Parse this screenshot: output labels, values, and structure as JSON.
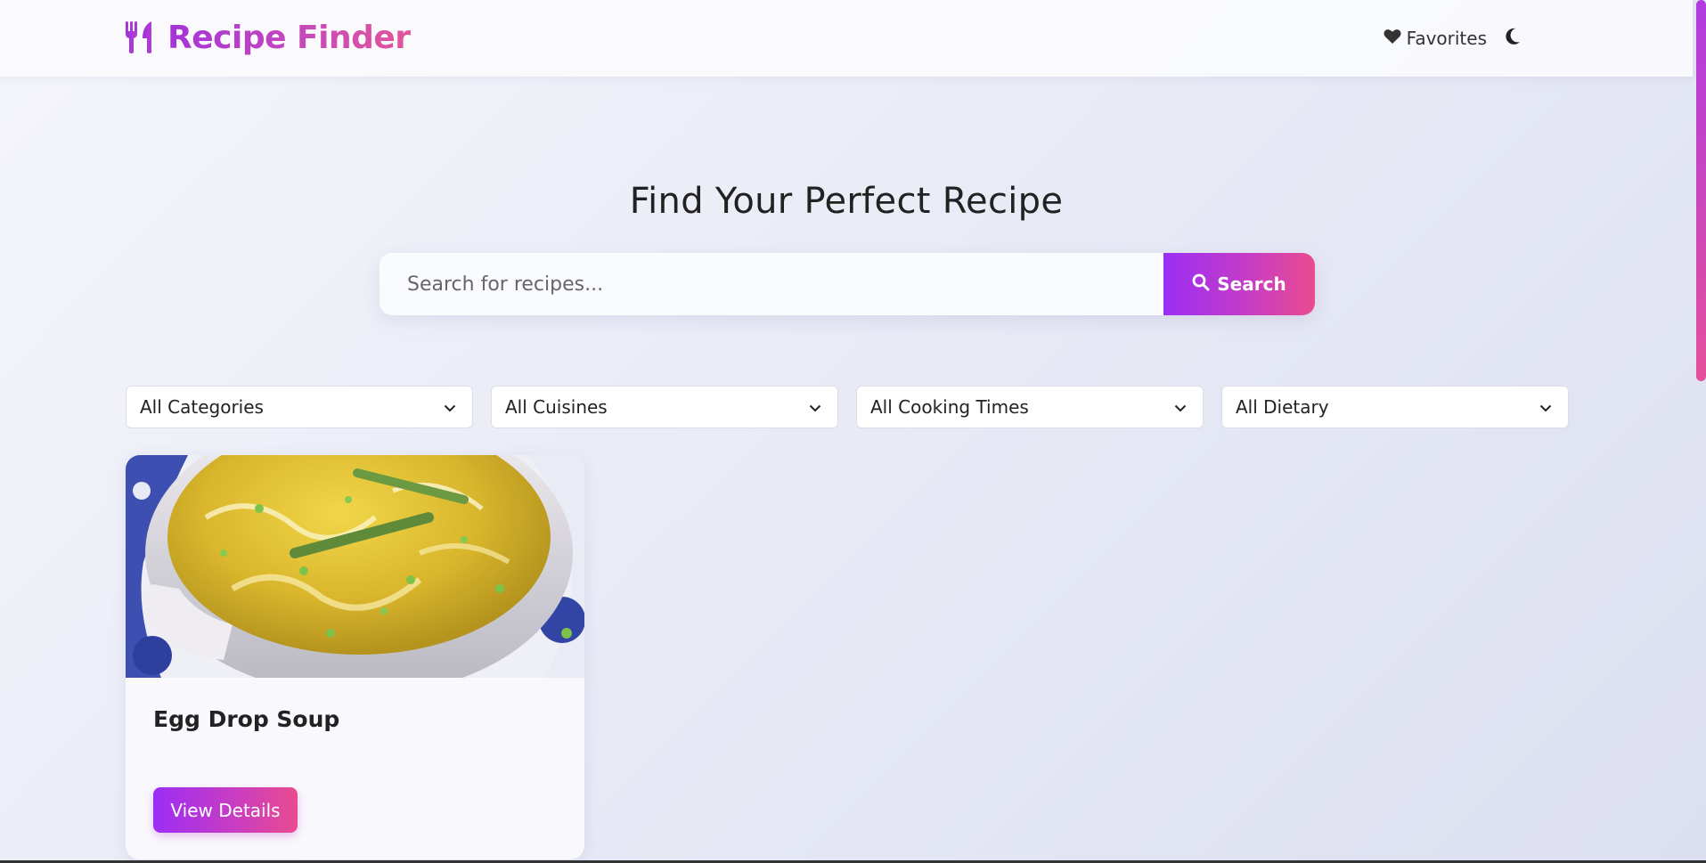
{
  "header": {
    "brand_title": "Recipe Finder",
    "brand_icon": "utensils-icon",
    "favorites_label": "Favorites",
    "favorites_icon": "heart-icon",
    "theme_icon": "moon-icon"
  },
  "hero": {
    "title": "Find Your Perfect Recipe"
  },
  "search": {
    "placeholder": "Search for recipes...",
    "value": "",
    "button_label": "Search",
    "button_icon": "search-icon"
  },
  "filters": [
    {
      "value": "All Categories"
    },
    {
      "value": "All Cuisines"
    },
    {
      "value": "All Cooking Times"
    },
    {
      "value": "All Dietary"
    }
  ],
  "recipes": [
    {
      "title": "Egg Drop Soup",
      "button_label": "View Details"
    }
  ],
  "colors": {
    "accent_start": "#9b2ef5",
    "accent_end": "#ea4b8f",
    "brand_purple": "#a534d8"
  }
}
